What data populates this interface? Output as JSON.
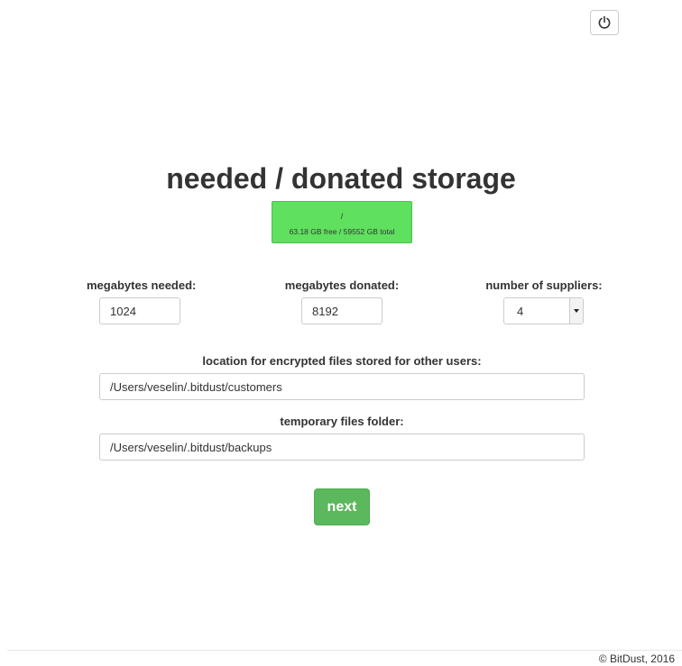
{
  "header": {
    "power_icon": "power-icon"
  },
  "title": "needed / donated storage",
  "storage": {
    "path": "/",
    "stats": "63.18 GB free / 59552 GB total",
    "color": "#5fe05f"
  },
  "form": {
    "megabytes_needed_label": "megabytes needed:",
    "megabytes_needed_value": "1024",
    "megabytes_donated_label": "megabytes donated:",
    "megabytes_donated_value": "8192",
    "suppliers_label": "number of suppliers:",
    "suppliers_value": "4",
    "customers_location_label": "location for encrypted files stored for other users:",
    "customers_location_value": "/Users/veselin/.bitdust/customers",
    "temp_folder_label": "temporary files folder:",
    "temp_folder_value": "/Users/veselin/.bitdust/backups"
  },
  "next_button_label": "next",
  "accent_color": "#5cb85c",
  "footer": {
    "copyright": "© BitDust, 2016"
  }
}
